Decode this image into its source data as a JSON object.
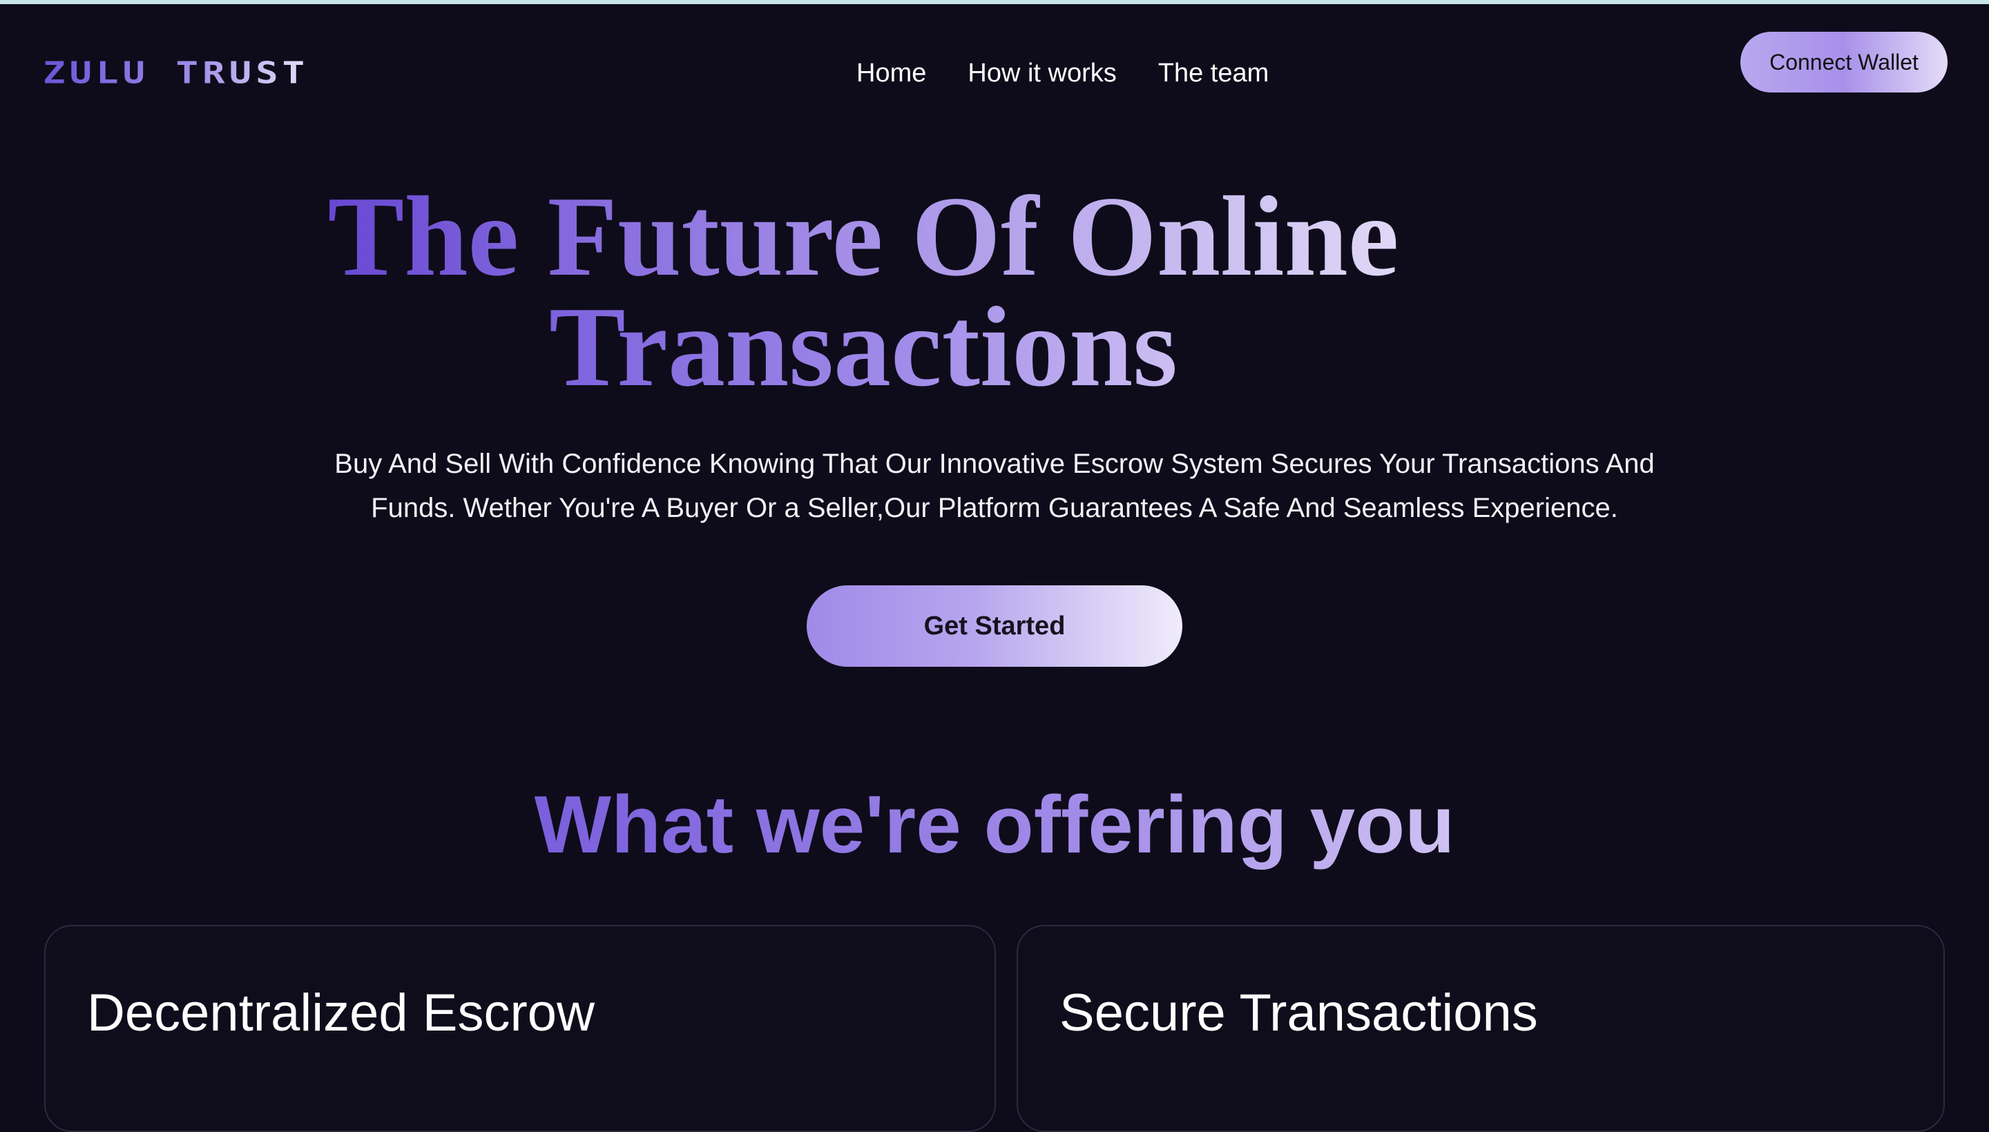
{
  "nav": {
    "logo_text": "ZULU TRUST",
    "links": [
      {
        "label": "Home"
      },
      {
        "label": "How it works"
      },
      {
        "label": "The team"
      }
    ],
    "connect_label": "Connect Wallet"
  },
  "hero": {
    "title_line1": "The Future Of Online",
    "title_line2": "Transactions",
    "subtitle_line1": "Buy And Sell With Confidence Knowing That Our Innovative Escrow System Secures Your Transactions And",
    "subtitle_line2": "Funds. Wether You're A Buyer Or a Seller,Our Platform Guarantees A Safe And Seamless Experience.",
    "cta_label": "Get Started"
  },
  "offering": {
    "title": "What we're offering you",
    "cards": [
      {
        "title": "Decentralized Escrow",
        "body": ""
      },
      {
        "title": "Secure Transactions",
        "body": ""
      }
    ]
  },
  "colors": {
    "background": "#0e0c1a",
    "accent_start": "#6848d2",
    "accent_end": "#e0d8f6",
    "top_strip": "#c8e6ea"
  }
}
